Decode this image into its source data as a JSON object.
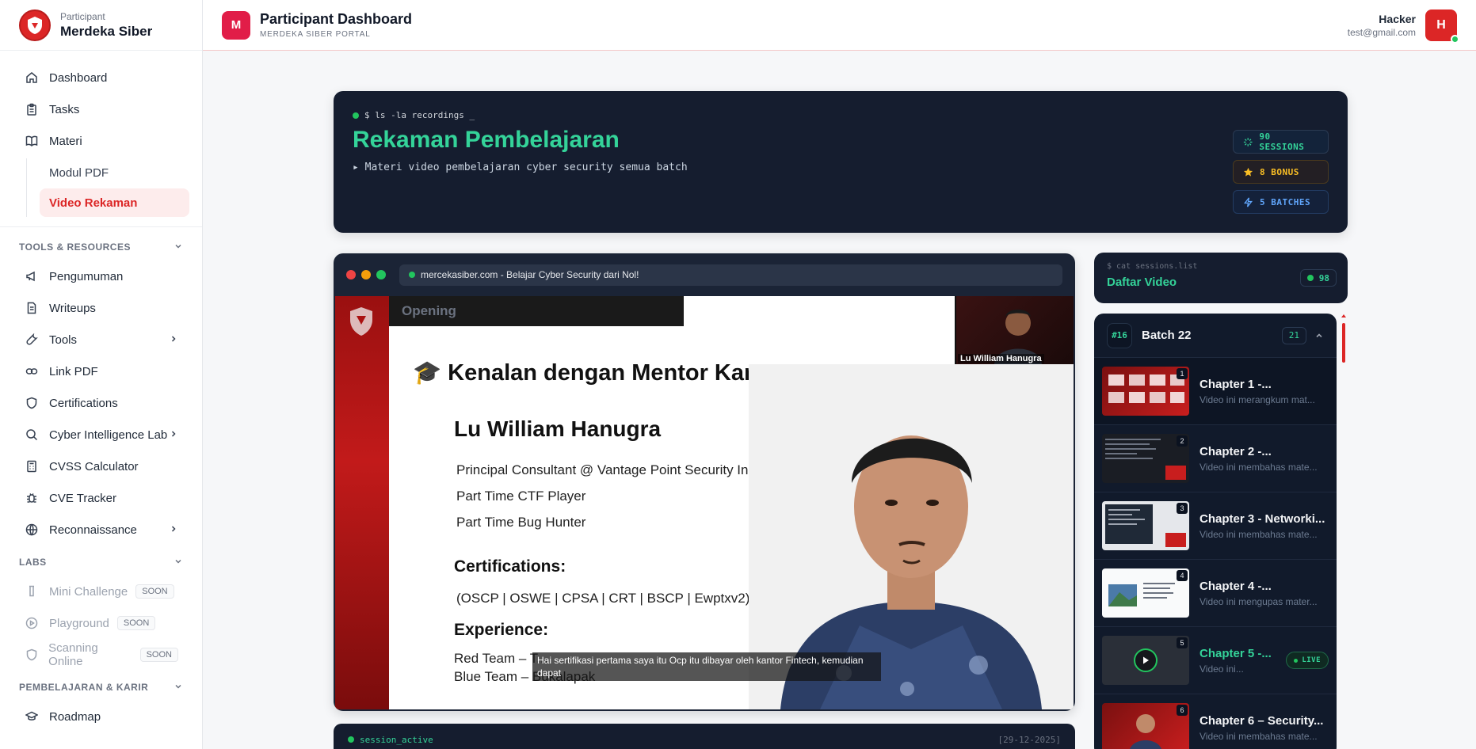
{
  "brand": {
    "role": "Participant",
    "name": "Merdeka Siber"
  },
  "nav": {
    "dashboard": "Dashboard",
    "tasks": "Tasks",
    "materi": "Materi",
    "modul_pdf": "Modul PDF",
    "video_rekaman": "Video Rekaman"
  },
  "tools": {
    "heading": "TOOLS & RESOURCES",
    "items": [
      "Pengumuman",
      "Writeups",
      "Tools",
      "Link PDF",
      "Certifications",
      "Cyber Intelligence Lab",
      "CVSS Calculator",
      "CVE Tracker",
      "Reconnaissance"
    ]
  },
  "labs": {
    "heading": "LABS",
    "items": [
      "Mini Challenge",
      "Playground",
      "Scanning Online"
    ],
    "soon": "SOON"
  },
  "career": {
    "heading": "PEMBELAJARAN & KARIR",
    "items": [
      "Roadmap"
    ]
  },
  "header": {
    "badge": "M",
    "title": "Participant Dashboard",
    "subtitle": "MERDEKA SIBER PORTAL",
    "user_name": "Hacker",
    "user_email": "test@gmail.com",
    "avatar": "H"
  },
  "hero": {
    "command": "$ ls -la recordings _",
    "title": "Rekaman Pembelajaran",
    "description": "▸ Materi video pembelajaran cyber security semua batch",
    "stats": [
      "90 SESSIONS",
      "8 BONUS",
      "5 BATCHES"
    ]
  },
  "player": {
    "url": "mercekasiber.com - Belajar Cyber Security dari Nol!",
    "slide_tab": "Opening",
    "cam_name": "Lu William Hanugra",
    "slide_title": "🎓 Kenalan dengan Mentor Kamu!",
    "mentor_name": "Lu William Hanugra",
    "roles": [
      "Principal Consultant @ Vantage Point Security Indonesia",
      "Part Time CTF Player",
      "Part Time Bug Hunter"
    ],
    "cert_heading": "Certifications:",
    "certs": "(OSCP | OSWE | CPSA | CRT | BSCP | Ewptxv2)",
    "exp_heading": "Experience:",
    "exp": [
      "Red Team – T...",
      "Blue Team – Bukalapak"
    ],
    "caption": "Hai sertifikasi pertama saya itu Ocp itu dibayar oleh kantor Fintech, kemudian dapat",
    "session_status": "session_active",
    "session_date": "[29-12-2025]"
  },
  "video_list": {
    "command": "$ cat sessions.list",
    "title": "Daftar Video",
    "count": "98",
    "batch_num": "#16",
    "batch_name": "Batch 22",
    "batch_count": "21",
    "live": "LIVE",
    "items": [
      {
        "n": "1",
        "title": "Chapter 1 -...",
        "desc": "Video ini merangkum mat..."
      },
      {
        "n": "2",
        "title": "Chapter 2 -...",
        "desc": "Video ini membahas mate..."
      },
      {
        "n": "3",
        "title": "Chapter 3 - Networki...",
        "desc": "Video ini membahas mate..."
      },
      {
        "n": "4",
        "title": "Chapter 4 -...",
        "desc": "Video ini mengupas mater..."
      },
      {
        "n": "5",
        "title": "Chapter 5 -...",
        "desc": "Video ini..."
      },
      {
        "n": "6",
        "title": "Chapter 6 – Security...",
        "desc": "Video ini membahas mate..."
      }
    ]
  },
  "colors": {
    "accent": "#dc2626",
    "terminal_green": "#34d399",
    "dark_panel": "#151d2f"
  }
}
